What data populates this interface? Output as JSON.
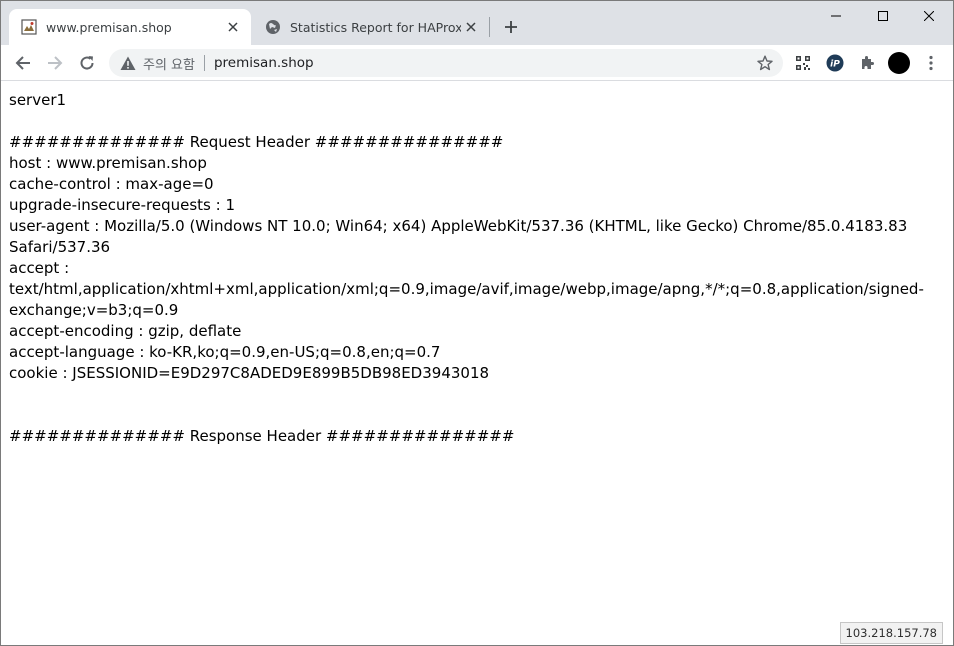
{
  "tabs": [
    {
      "title": "www.premisan.shop",
      "favicon": "site-favicon",
      "active": true
    },
    {
      "title": "Statistics Report for HAProxy",
      "favicon": "globe-icon",
      "active": false
    }
  ],
  "window_controls": {
    "minimize": "minimize-icon",
    "maximize": "maximize-icon",
    "close": "close-icon"
  },
  "address_bar": {
    "security_label": "주의 요함",
    "url": "premisan.shop"
  },
  "page": {
    "lines": [
      "server1",
      "",
      "############## Request Header ###############",
      "host : www.premisan.shop",
      "cache-control : max-age=0",
      "upgrade-insecure-requests : 1",
      "user-agent : Mozilla/5.0 (Windows NT 10.0; Win64; x64) AppleWebKit/537.36 (KHTML, like Gecko) Chrome/85.0.4183.83 Safari/537.36",
      "accept : text/html,application/xhtml+xml,application/xml;q=0.9,image/avif,image/webp,image/apng,*/*;q=0.8,application/signed-exchange;v=b3;q=0.9",
      "accept-encoding : gzip, deflate",
      "accept-language : ko-KR,ko;q=0.9,en-US;q=0.8,en;q=0.7",
      "cookie : JSESSIONID=E9D297C8ADED9E899B5DB98ED3943018",
      "",
      "",
      "############## Response Header ###############"
    ]
  },
  "status_bar": {
    "text": "103.218.157.78"
  }
}
